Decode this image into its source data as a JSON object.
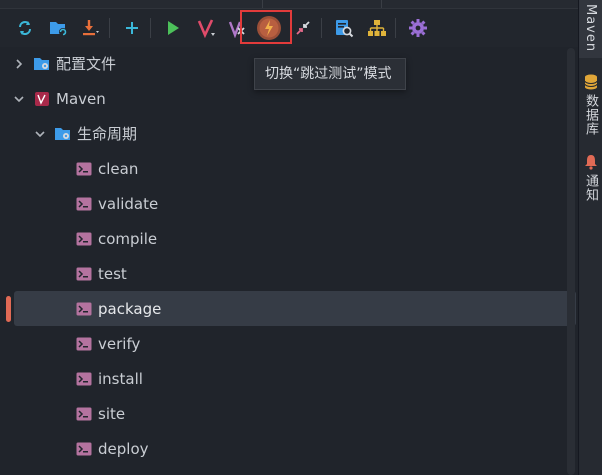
{
  "toolbar": {
    "buttons": [
      {
        "name": "reload-all-projects",
        "icon": "sync-icon"
      },
      {
        "name": "generate-sources",
        "icon": "folder-refresh-icon"
      },
      {
        "name": "download-sources",
        "icon": "download-icon"
      },
      {
        "name": "add-maven-project",
        "icon": "plus-icon"
      },
      {
        "name": "run-maven-build",
        "icon": "run-icon"
      },
      {
        "name": "execute-maven-goal",
        "icon": "maven-m-icon"
      },
      {
        "name": "toggle-offline-mode",
        "icon": "offline-icon"
      },
      {
        "name": "toggle-skip-tests-mode",
        "icon": "lightning-icon"
      },
      {
        "name": "collapse-all",
        "icon": "collapse-icon"
      },
      {
        "name": "show-dependencies",
        "icon": "analyze-icon"
      },
      {
        "name": "show-diagram",
        "icon": "hierarchy-icon"
      },
      {
        "name": "maven-settings",
        "icon": "gear-icon"
      }
    ]
  },
  "tooltip": {
    "text": "切换“跳过测试”模式"
  },
  "tree": {
    "profiles_label": "配置文件",
    "project_label": "Maven",
    "lifecycle_label": "生命周期",
    "goals": [
      "clean",
      "validate",
      "compile",
      "test",
      "package",
      "verify",
      "install",
      "site",
      "deploy"
    ],
    "selected_goal": "package"
  },
  "side_panel": {
    "tabs": [
      {
        "label": "Maven",
        "icon": "maven-icon",
        "active": true
      },
      {
        "label": "数据库",
        "icon": "database-icon",
        "active": false
      },
      {
        "label": "通知",
        "icon": "bell-icon",
        "active": false
      }
    ]
  },
  "colors": {
    "accent_highlight": "#e23b3b",
    "selection_marker": "#e06a55",
    "folder_blue": "#3d9be9",
    "goal_icon": "#c77fbd"
  }
}
